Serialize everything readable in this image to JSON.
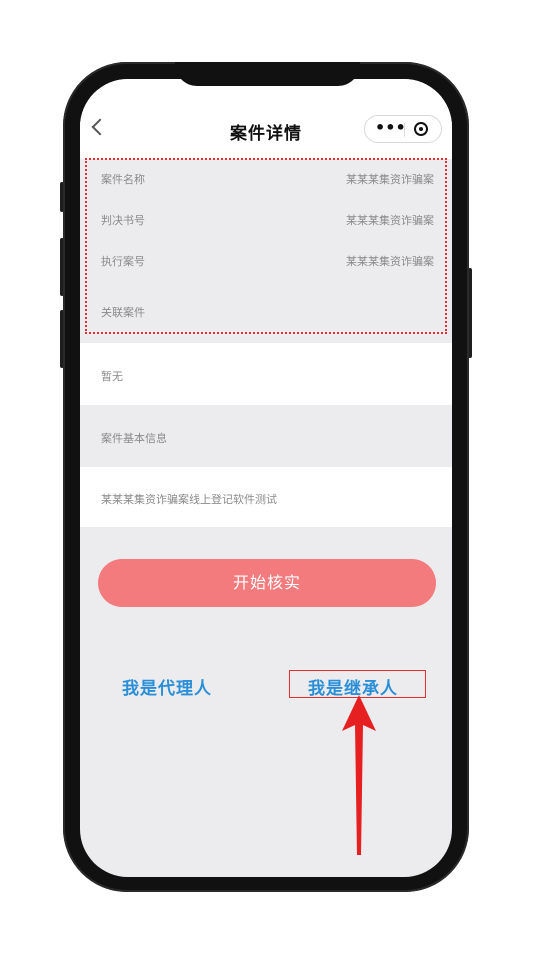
{
  "navbar": {
    "title": "案件详情",
    "more_icon": "more-dots-icon",
    "target_icon": "target-icon"
  },
  "case_info": {
    "rows": [
      {
        "label": "案件名称",
        "value": "某某某集资诈骗案"
      },
      {
        "label": "判决书号",
        "value": "某某某集资诈骗案"
      },
      {
        "label": "执行案号",
        "value": "某某某集资诈骗案"
      },
      {
        "label": "关联案件",
        "value": ""
      }
    ],
    "related_case_value": "暂无",
    "basic_info_label": "案件基本信息",
    "basic_info_value": "某某某集资诈骗案线上登记软件测试"
  },
  "actions": {
    "start_verify": "开始核实",
    "agent_link": "我是代理人",
    "heir_link": "我是继承人"
  },
  "annotation": {
    "box_color": "#e03030",
    "arrow_color": "#e62020"
  },
  "colors": {
    "button": "#f37a7d",
    "link": "#2b8fd8",
    "background": "#ececef"
  }
}
